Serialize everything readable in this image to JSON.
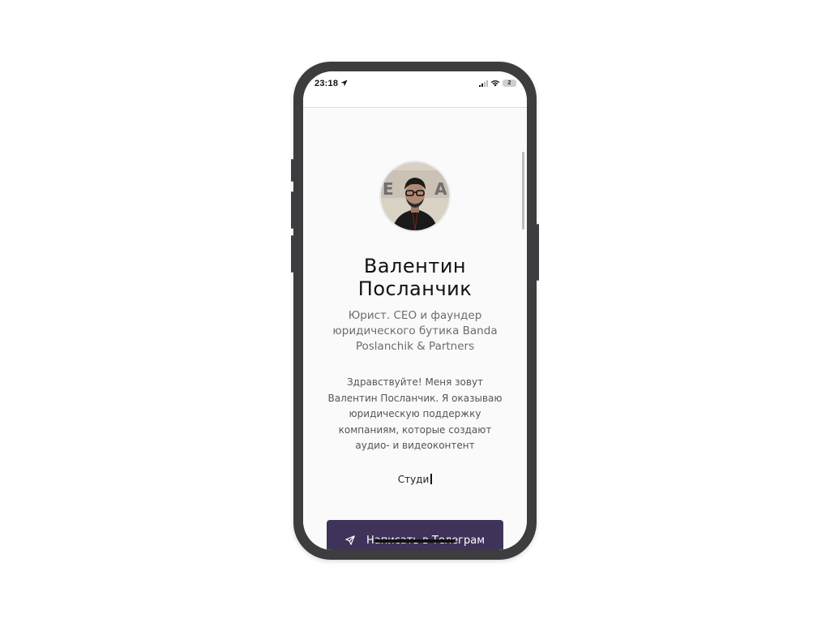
{
  "status_bar": {
    "time": "23:18",
    "battery": "2"
  },
  "profile": {
    "name_line1": "Валентин",
    "name_line2": "Посланчик",
    "subtitle_lines": [
      "Юрист. CEO и фаундер",
      "юридического бутика Banda",
      "Poslanchik & Partners"
    ],
    "about_lines": [
      "Здравствуйте! Меня зовут",
      "Валентин Посланчик. Я оказываю",
      "юридическую поддержку",
      "компаниям, которые создают",
      "аудио- и видеоконтент"
    ],
    "typing_text": "Студи"
  },
  "cta": {
    "telegram_label": "Написать в Телеграм"
  },
  "colors": {
    "button_bg": "#40335a",
    "frame": "#3d3d40"
  },
  "icons": {
    "location": "location-arrow-icon",
    "send": "send-icon"
  }
}
